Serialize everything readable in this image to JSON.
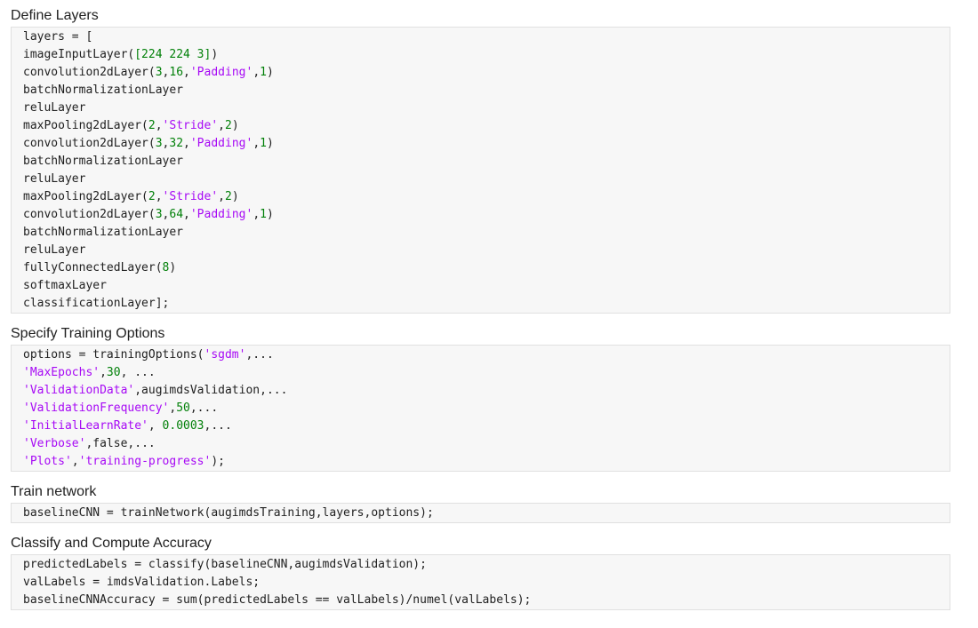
{
  "sections": [
    {
      "heading": "Define Layers",
      "lines": [
        [
          {
            "t": "layers = ["
          }
        ],
        [
          {
            "t": "imageInputLayer("
          },
          {
            "t": "[224 224 3]",
            "c": "num"
          },
          {
            "t": ")"
          }
        ],
        [
          {
            "t": "convolution2dLayer("
          },
          {
            "t": "3",
            "c": "num"
          },
          {
            "t": ","
          },
          {
            "t": "16",
            "c": "num"
          },
          {
            "t": ","
          },
          {
            "t": "'Padding'",
            "c": "str"
          },
          {
            "t": ","
          },
          {
            "t": "1",
            "c": "num"
          },
          {
            "t": ")"
          }
        ],
        [
          {
            "t": "batchNormalizationLayer"
          }
        ],
        [
          {
            "t": "reluLayer"
          }
        ],
        [
          {
            "t": "maxPooling2dLayer("
          },
          {
            "t": "2",
            "c": "num"
          },
          {
            "t": ","
          },
          {
            "t": "'Stride'",
            "c": "str"
          },
          {
            "t": ","
          },
          {
            "t": "2",
            "c": "num"
          },
          {
            "t": ")"
          }
        ],
        [
          {
            "t": "convolution2dLayer("
          },
          {
            "t": "3",
            "c": "num"
          },
          {
            "t": ","
          },
          {
            "t": "32",
            "c": "num"
          },
          {
            "t": ","
          },
          {
            "t": "'Padding'",
            "c": "str"
          },
          {
            "t": ","
          },
          {
            "t": "1",
            "c": "num"
          },
          {
            "t": ")"
          }
        ],
        [
          {
            "t": "batchNormalizationLayer"
          }
        ],
        [
          {
            "t": "reluLayer"
          }
        ],
        [
          {
            "t": "maxPooling2dLayer("
          },
          {
            "t": "2",
            "c": "num"
          },
          {
            "t": ","
          },
          {
            "t": "'Stride'",
            "c": "str"
          },
          {
            "t": ","
          },
          {
            "t": "2",
            "c": "num"
          },
          {
            "t": ")"
          }
        ],
        [
          {
            "t": "convolution2dLayer("
          },
          {
            "t": "3",
            "c": "num"
          },
          {
            "t": ","
          },
          {
            "t": "64",
            "c": "num"
          },
          {
            "t": ","
          },
          {
            "t": "'Padding'",
            "c": "str"
          },
          {
            "t": ","
          },
          {
            "t": "1",
            "c": "num"
          },
          {
            "t": ")"
          }
        ],
        [
          {
            "t": "batchNormalizationLayer"
          }
        ],
        [
          {
            "t": "reluLayer"
          }
        ],
        [
          {
            "t": "fullyConnectedLayer("
          },
          {
            "t": "8",
            "c": "num"
          },
          {
            "t": ")"
          }
        ],
        [
          {
            "t": "softmaxLayer"
          }
        ],
        [
          {
            "t": "classificationLayer];"
          }
        ]
      ]
    },
    {
      "heading": "Specify Training Options",
      "lines": [
        [
          {
            "t": "options = trainingOptions("
          },
          {
            "t": "'sgdm'",
            "c": "str"
          },
          {
            "t": ",..."
          }
        ],
        [
          {
            "t": "'MaxEpochs'",
            "c": "str"
          },
          {
            "t": ","
          },
          {
            "t": "30",
            "c": "num"
          },
          {
            "t": ", ..."
          }
        ],
        [
          {
            "t": "'ValidationData'",
            "c": "str"
          },
          {
            "t": ",augimdsValidation,..."
          }
        ],
        [
          {
            "t": "'ValidationFrequency'",
            "c": "str"
          },
          {
            "t": ","
          },
          {
            "t": "50",
            "c": "num"
          },
          {
            "t": ",..."
          }
        ],
        [
          {
            "t": "'InitialLearnRate'",
            "c": "str"
          },
          {
            "t": ", "
          },
          {
            "t": "0.0003",
            "c": "num"
          },
          {
            "t": ",..."
          }
        ],
        [
          {
            "t": "'Verbose'",
            "c": "str"
          },
          {
            "t": ",false,..."
          }
        ],
        [
          {
            "t": "'Plots'",
            "c": "str"
          },
          {
            "t": ","
          },
          {
            "t": "'training-progress'",
            "c": "str"
          },
          {
            "t": ");"
          }
        ]
      ]
    },
    {
      "heading": "Train network",
      "lines": [
        [
          {
            "t": "baselineCNN = trainNetwork(augimdsTraining,layers,options);"
          }
        ]
      ]
    },
    {
      "heading": "Classify and Compute Accuracy",
      "lines": [
        [
          {
            "t": "predictedLabels = classify(baselineCNN,augimdsValidation);"
          }
        ],
        [
          {
            "t": "valLabels = imdsValidation.Labels;"
          }
        ],
        [
          {
            "t": "baselineCNNAccuracy = sum(predictedLabels == valLabels)/numel(valLabels);"
          }
        ]
      ]
    }
  ]
}
